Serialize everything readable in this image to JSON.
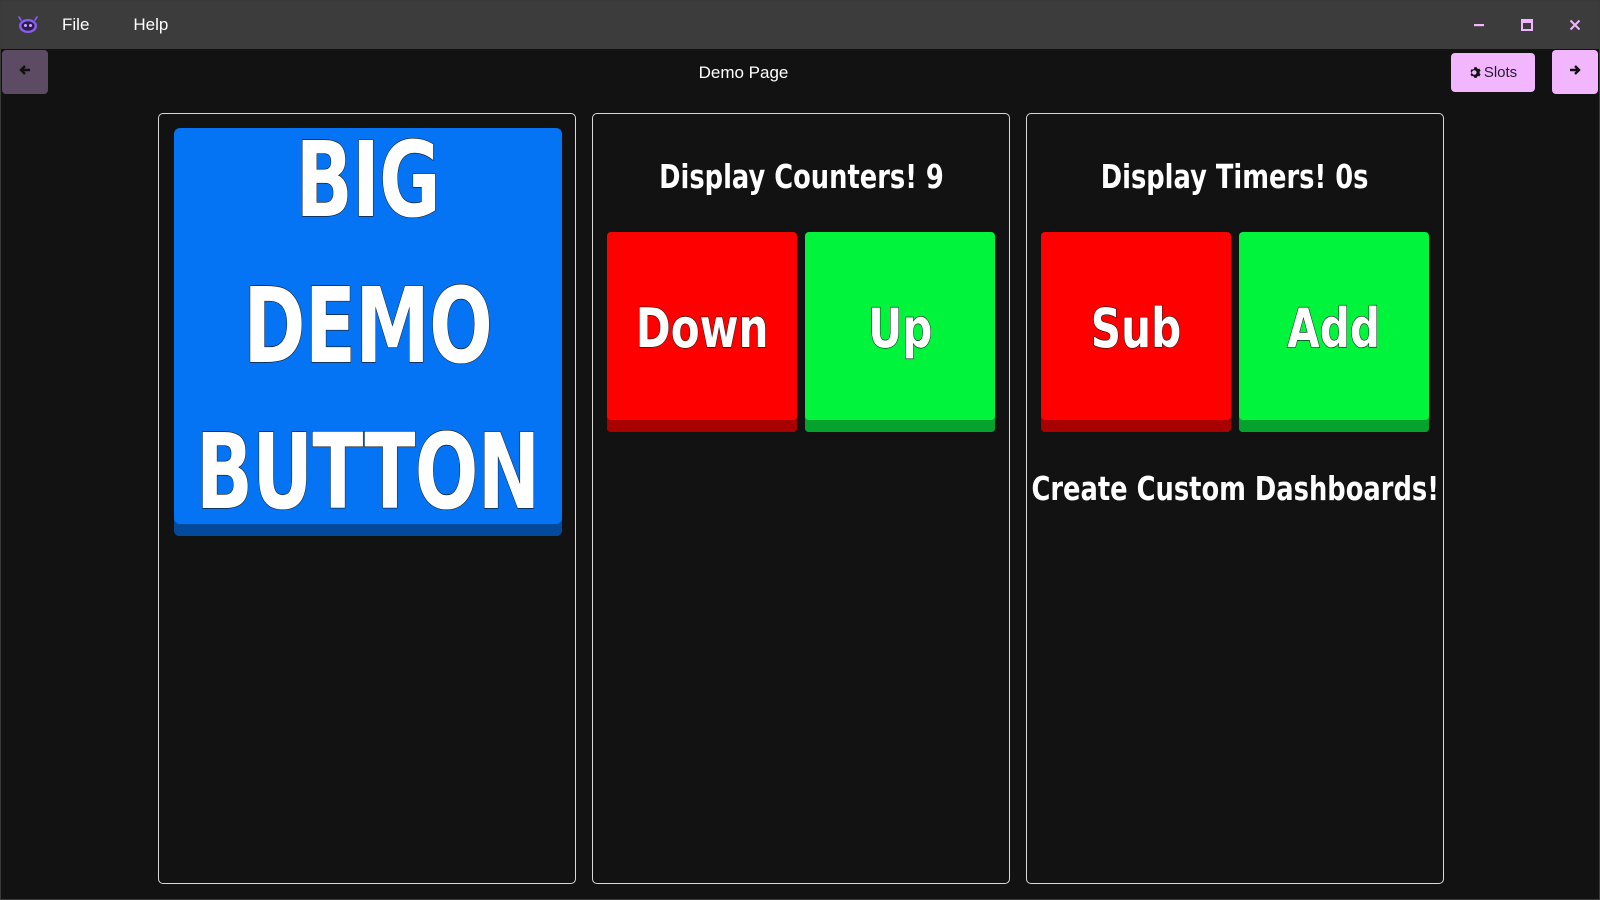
{
  "colors": {
    "titlebar": "#3c3c3c",
    "background": "#121212",
    "accent": "#f2b6ff",
    "big_button": "#0474f4",
    "red_tile": "#ff0000",
    "green_tile": "#00f43c"
  },
  "titlebar": {
    "logo_icon": "app-logo-icon",
    "menu": [
      {
        "label": "File"
      },
      {
        "label": "Help"
      }
    ],
    "controls": [
      "minimize-icon",
      "maximize-icon",
      "close-icon"
    ]
  },
  "header": {
    "back_icon": "arrow-left-icon",
    "title": "Demo Page",
    "slots_label": "Slots",
    "slots_icon": "gear-icon",
    "forward_icon": "arrow-right-icon"
  },
  "panels": {
    "big_button": {
      "lines": [
        "BIG",
        "DEMO",
        "BUTTON"
      ]
    },
    "counters": {
      "heading": "Display Counters! 9",
      "down_label": "Down",
      "up_label": "Up"
    },
    "timers": {
      "heading": "Display Timers! 0s",
      "sub_label": "Sub",
      "add_label": "Add",
      "footer": "Create Custom Dashboards!"
    }
  }
}
